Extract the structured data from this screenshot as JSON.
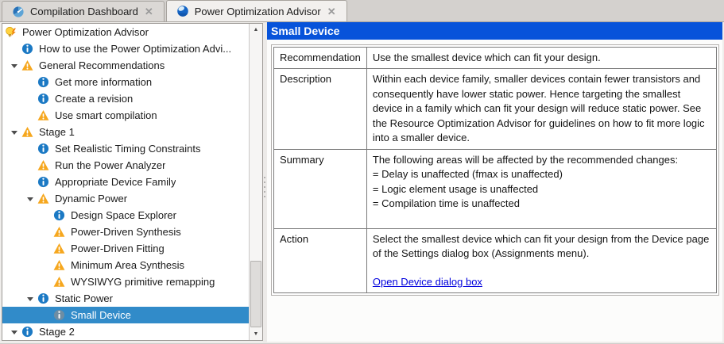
{
  "tabs": [
    {
      "label": "Compilation Dashboard",
      "icon": "compilation-dashboard-icon",
      "active": false,
      "close_glyph": "✕"
    },
    {
      "label": "Power Optimization Advisor",
      "icon": "power-advisor-icon",
      "active": true,
      "close_glyph": "✕"
    }
  ],
  "tree": {
    "items": [
      {
        "label": "Power Optimization Advisor",
        "icon": "advisor-bulb",
        "level": 0
      },
      {
        "label": "How to use the Power Optimization Advi...",
        "icon": "info",
        "level": 1
      },
      {
        "label": "General Recommendations",
        "icon": "warning",
        "level": 1,
        "expanded": true
      },
      {
        "label": "Get more information",
        "icon": "info",
        "level": 2
      },
      {
        "label": "Create a revision",
        "icon": "info",
        "level": 2
      },
      {
        "label": "Use smart compilation",
        "icon": "warning",
        "level": 2
      },
      {
        "label": "Stage 1",
        "icon": "warning",
        "level": 1,
        "expanded": true
      },
      {
        "label": "Set Realistic Timing Constraints",
        "icon": "info",
        "level": 2
      },
      {
        "label": "Run the Power Analyzer",
        "icon": "warning",
        "level": 2
      },
      {
        "label": "Appropriate Device Family",
        "icon": "info",
        "level": 2
      },
      {
        "label": "Dynamic Power",
        "icon": "warning",
        "level": 2,
        "expanded": true
      },
      {
        "label": "Design Space Explorer",
        "icon": "info",
        "level": 3
      },
      {
        "label": "Power-Driven Synthesis",
        "icon": "warning",
        "level": 3
      },
      {
        "label": "Power-Driven Fitting",
        "icon": "warning",
        "level": 3
      },
      {
        "label": "Minimum Area Synthesis",
        "icon": "warning",
        "level": 3
      },
      {
        "label": "WYSIWYG primitive remapping",
        "icon": "warning",
        "level": 3
      },
      {
        "label": "Static Power",
        "icon": "info",
        "level": 2,
        "expanded": true
      },
      {
        "label": "Small Device",
        "icon": "info",
        "level": 3,
        "selected": true
      },
      {
        "label": "Stage 2",
        "icon": "info",
        "level": 1,
        "expanded": true
      }
    ]
  },
  "detail": {
    "title": "Small Device",
    "rows": [
      {
        "label": "Recommendation",
        "lines": [
          "Use the smallest device which can fit your design."
        ]
      },
      {
        "label": "Description",
        "lines": [
          "Within each device family, smaller devices contain fewer transistors and consequently have lower static power. Hence targeting the smallest device in a family which can fit your design will reduce static power. See the Resource Optimization Advisor for guidelines on how to fit more logic into a smaller device."
        ]
      },
      {
        "label": "Summary",
        "lines": [
          "The following areas will be affected by the recommended changes:",
          "= Delay is unaffected (fmax is unaffected)",
          "= Logic element usage is unaffected",
          "= Compilation time is unaffected"
        ]
      },
      {
        "label": "Action",
        "lines": [
          "Select the smallest device which can fit your design from the Device page of the Settings dialog box (Assignments menu)."
        ],
        "link": "Open Device dialog box"
      }
    ]
  },
  "scrollbar": {
    "up_glyph": "▲",
    "down_glyph": "▼"
  },
  "colors": {
    "selection": "#318bc9",
    "header_bar": "#0753da",
    "link": "#0000dd",
    "info_icon": "#1b79c4",
    "info_icon_muted": "#6e8da3",
    "warning_icon": "#f6a71e"
  }
}
